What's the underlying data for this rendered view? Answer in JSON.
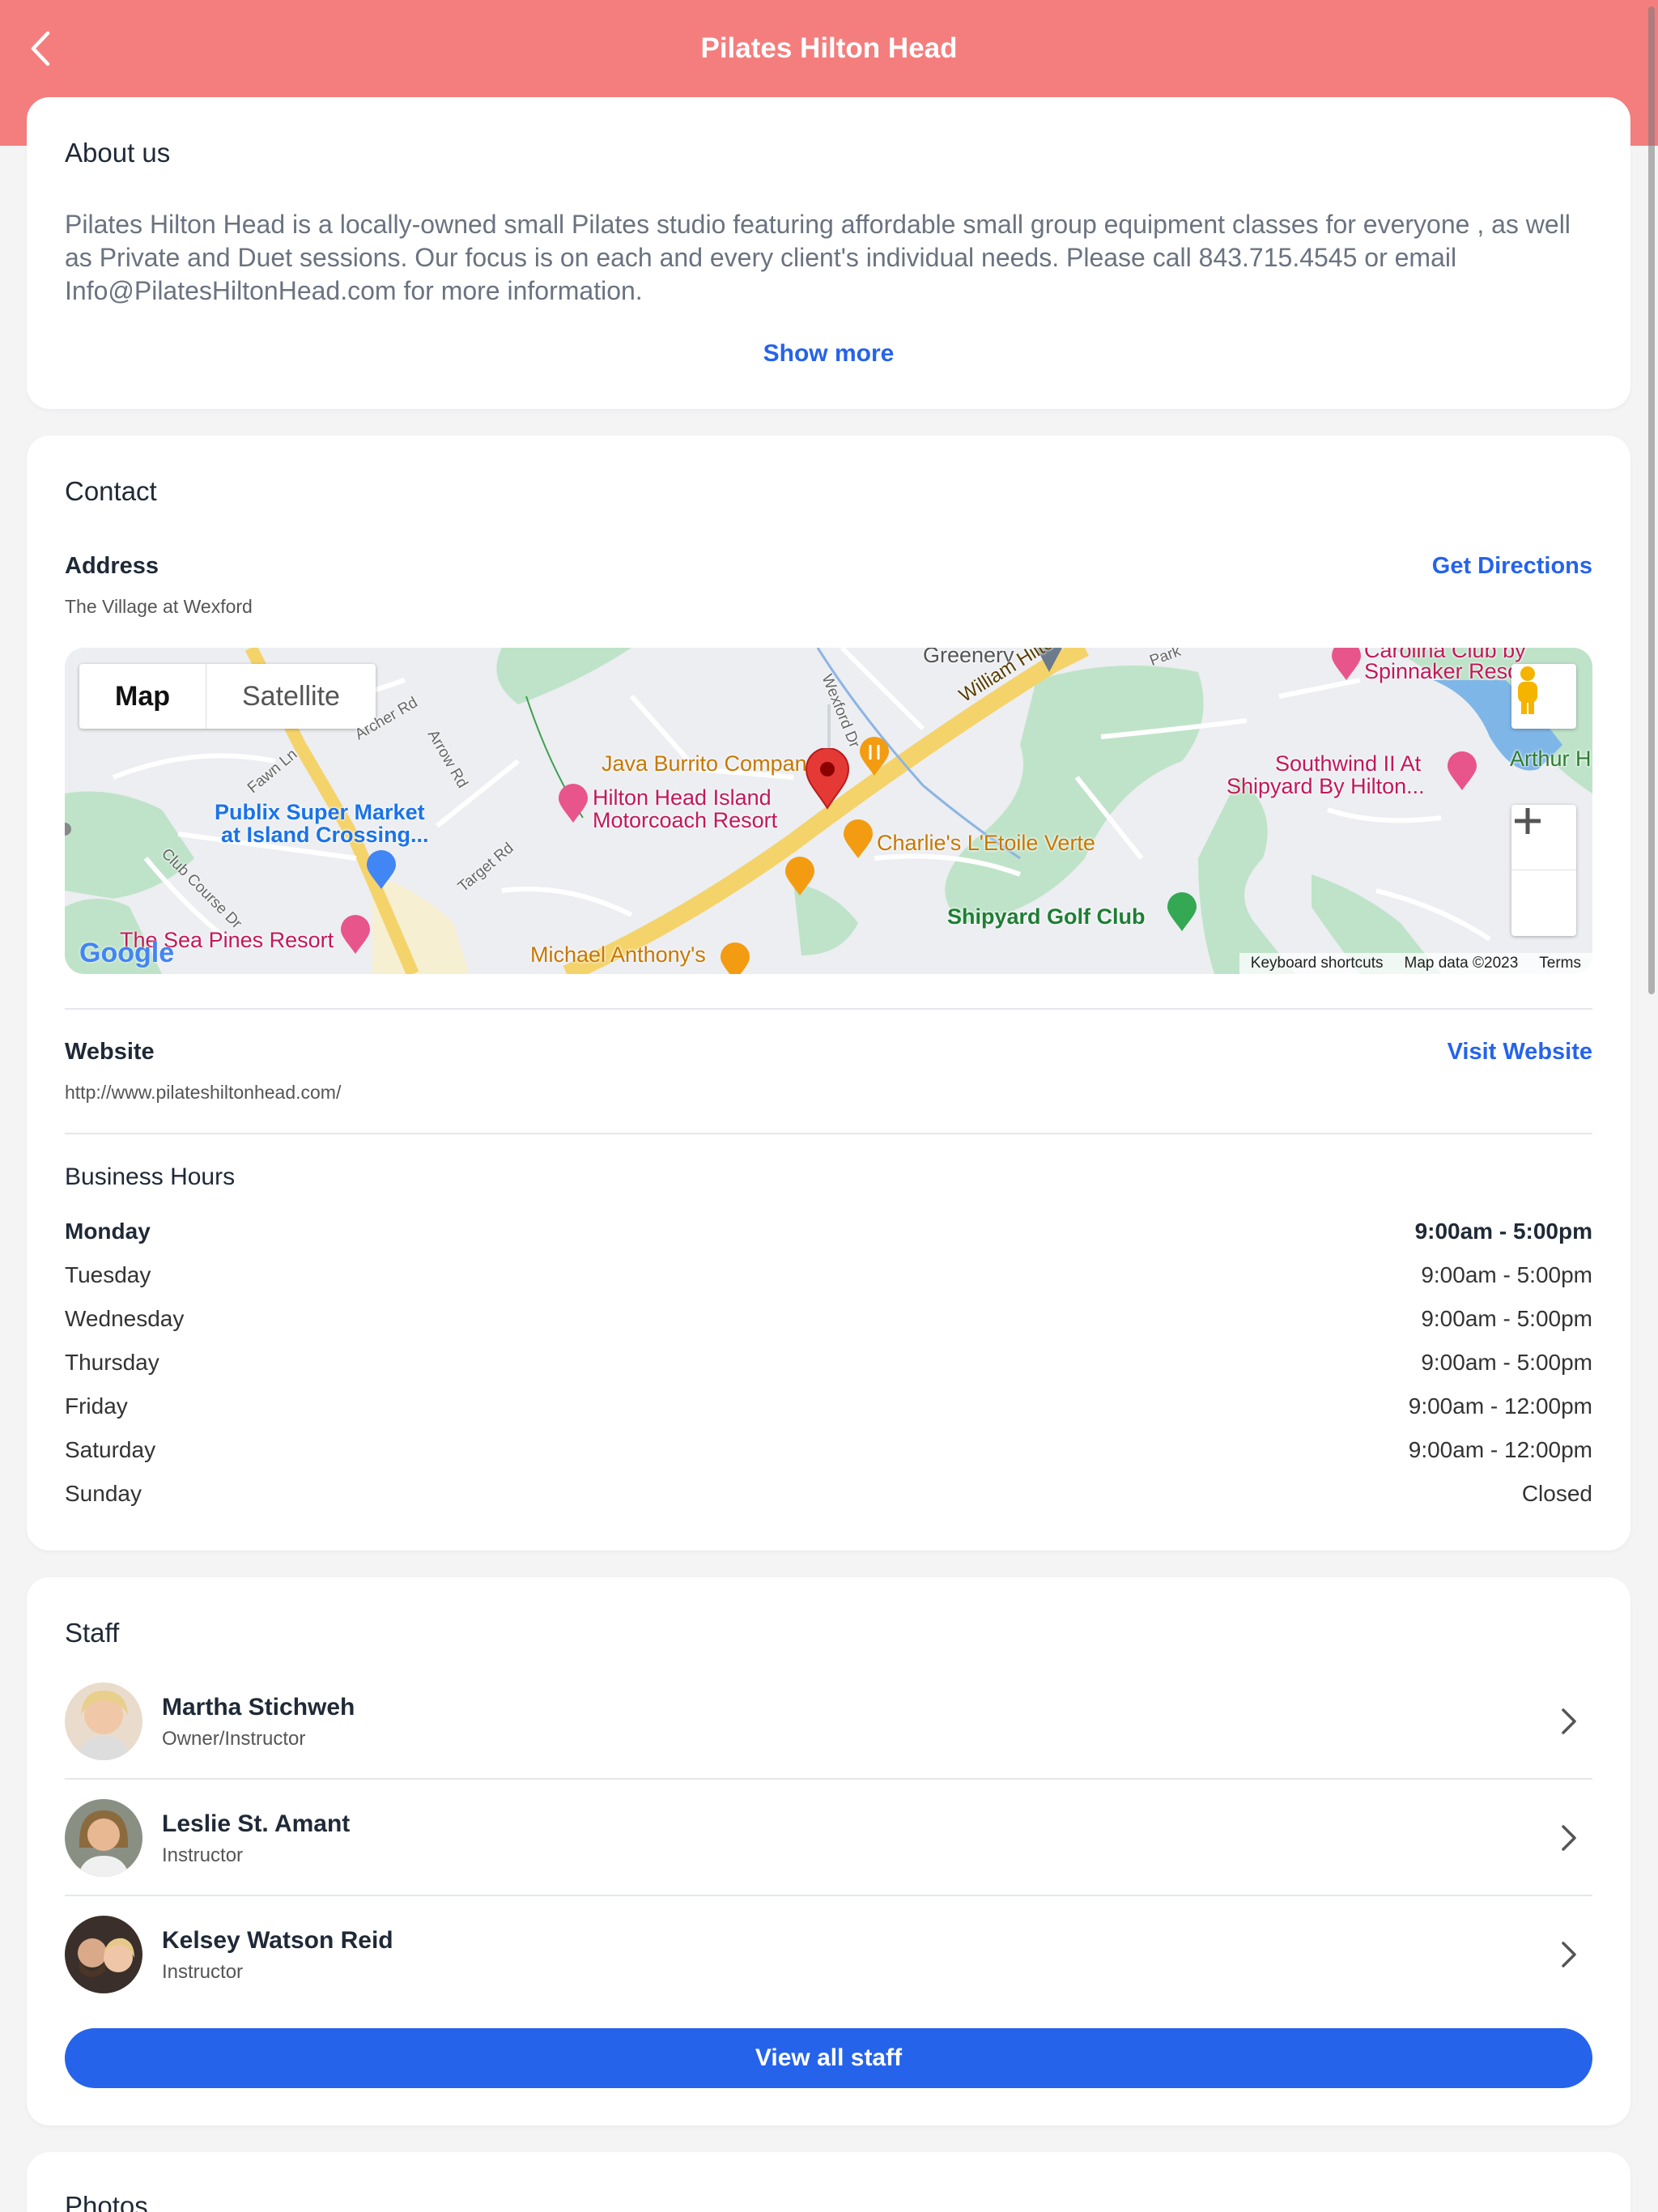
{
  "header": {
    "title": "Pilates Hilton Head"
  },
  "about": {
    "heading": "About us",
    "text": "Pilates Hilton Head is a locally-owned small Pilates studio featuring affordable small group equipment classes for everyone , as well as Private and Duet sessions.  Our focus is on each and every client's individual needs.  Please call 843.715.4545 or email Info@PilatesHiltonHead.com for more information.",
    "show_more": "Show more"
  },
  "contact": {
    "heading": "Contact",
    "address_label": "Address",
    "address_value": "The Village at Wexford",
    "directions_link": "Get Directions",
    "map": {
      "tab_map": "Map",
      "tab_satellite": "Satellite",
      "labels": {
        "greenery": "Greenery",
        "william_hilton": "William Hilton Pkwy",
        "carolina_club": "Carolina Club by",
        "spinnaker": "Spinnaker Reso",
        "java_burrito": "Java Burrito Compan",
        "hilton_head_island": "Hilton Head Island",
        "motorcoach": "Motorcoach Resort",
        "southwind_1": "Southwind II At",
        "southwind_2": "Shipyard By Hilton...",
        "arthur": "Arthur H",
        "publix_1": "Publix Super Market",
        "publix_2": "at Island Crossing...",
        "charlies": "Charlie's L'Etoile Verte",
        "shipyard_golf": "Shipyard Golf Club",
        "sea_pines": "The Sea Pines Resort",
        "michael_anthonys": "Michael Anthony's",
        "archer_rd": "Archer Rd",
        "arrow_rd": "Arrow Rd",
        "fawn_ln": "Fawn Ln",
        "target_rd": "Target Rd",
        "club_course": "Club Course Dr",
        "wexford_dr": "Wexford Dr",
        "park": "Park"
      },
      "google": "Google",
      "footer": {
        "shortcuts": "Keyboard shortcuts",
        "data": "Map data ©2023",
        "terms": "Terms"
      }
    },
    "website_label": "Website",
    "website_value": "http://www.pilateshiltonhead.com/",
    "website_link": "Visit Website",
    "hours_heading": "Business Hours",
    "hours": [
      {
        "day": "Monday",
        "time": "9:00am - 5:00pm"
      },
      {
        "day": "Tuesday",
        "time": "9:00am - 5:00pm"
      },
      {
        "day": "Wednesday",
        "time": "9:00am - 5:00pm"
      },
      {
        "day": "Thursday",
        "time": "9:00am - 5:00pm"
      },
      {
        "day": "Friday",
        "time": "9:00am - 12:00pm"
      },
      {
        "day": "Saturday",
        "time": "9:00am - 12:00pm"
      },
      {
        "day": "Sunday",
        "time": "Closed"
      }
    ]
  },
  "staff": {
    "heading": "Staff",
    "members": [
      {
        "name": "Martha Stichweh",
        "role": "Owner/Instructor"
      },
      {
        "name": "Leslie St. Amant",
        "role": "Instructor"
      },
      {
        "name": "Kelsey Watson Reid",
        "role": "Instructor"
      }
    ],
    "view_all": "View all staff"
  },
  "photos": {
    "heading": "Photos"
  },
  "colors": {
    "header": "#f47e7e",
    "accent": "#2563eb",
    "background": "#f4f4f5"
  },
  "icons": {
    "back": "chevron-left-icon",
    "row": "chevron-right-icon",
    "zoom_in": "plus-icon",
    "zoom_out": "minus-icon",
    "pegman": "pegman-icon",
    "fullscreen": "fullscreen-icon"
  }
}
